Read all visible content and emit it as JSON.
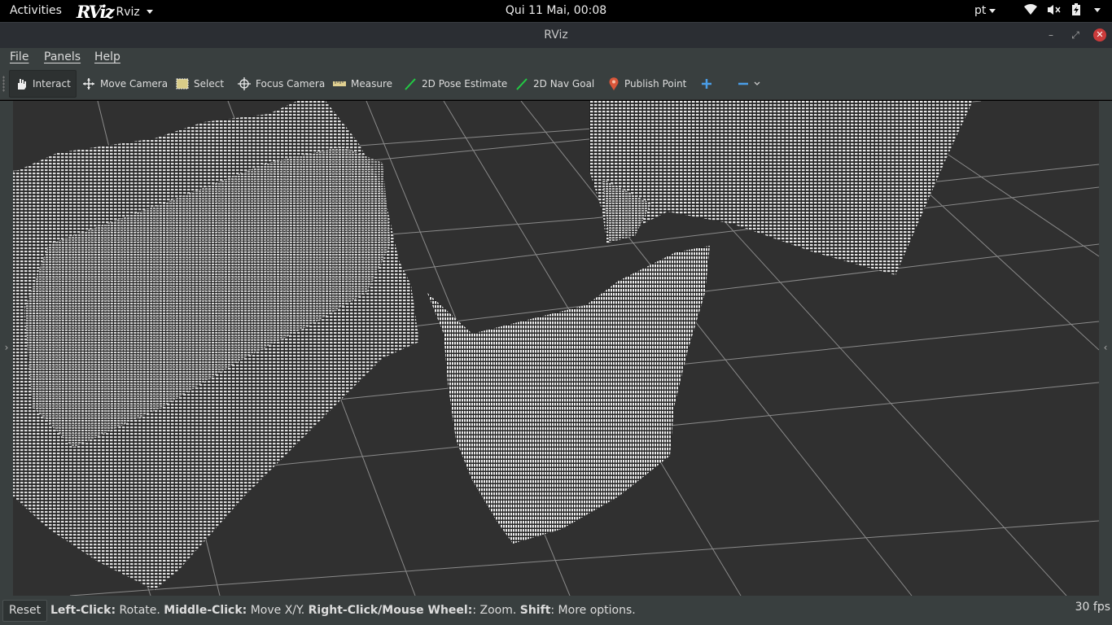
{
  "topbar": {
    "activities": "Activities",
    "app_logo": "RViz",
    "app_name": "Rviz",
    "clock": "Qui 11 Mai, 00:08",
    "language": "pt"
  },
  "window": {
    "title": "RViz"
  },
  "menu": {
    "file": "File",
    "panels": "Panels",
    "help": "Help"
  },
  "toolbar": {
    "interact": "Interact",
    "move_camera": "Move Camera",
    "select": "Select",
    "focus_camera": "Focus Camera",
    "measure": "Measure",
    "pose_estimate": "2D Pose Estimate",
    "nav_goal": "2D Nav Goal",
    "publish_point": "Publish Point"
  },
  "status": {
    "reset": "Reset",
    "left_click_key": "Left-Click:",
    "left_click_text": " Rotate. ",
    "middle_click_key": "Middle-Click:",
    "middle_click_text": " Move X/Y. ",
    "right_click_key": "Right-Click/Mouse Wheel:",
    "right_click_text": ": Zoom. ",
    "shift_key": "Shift",
    "shift_text": ": More options.",
    "fps": "30 fps"
  },
  "colors": {
    "viewport_bg": "#303030",
    "grid": "#a0a0a0",
    "points": "#e6e6e6",
    "nav_green": "#22cc44",
    "close_red": "#cc3b3b",
    "accent_blue": "#4a9ee8"
  }
}
